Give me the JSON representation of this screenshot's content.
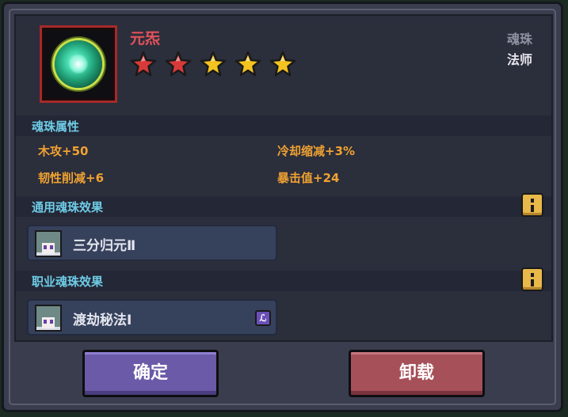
{
  "item": {
    "name": "元炁",
    "stars": 5,
    "star_colors": [
      "#d83a3a",
      "#d83a3a",
      "#f3c31f",
      "#f3c31f",
      "#f3c31f"
    ],
    "icon": "green-orb-icon"
  },
  "category": {
    "type": "魂珠",
    "class": "法师"
  },
  "attributes": {
    "title": "魂珠属性",
    "stats": [
      "木攻+50",
      "冷却缩减+3%",
      "韧性削减+6",
      "暴击值+24"
    ]
  },
  "general_effect": {
    "title": "通用魂珠效果",
    "effect_name": "三分归元Ⅱ"
  },
  "class_effect": {
    "title": "职业魂珠效果",
    "effect_name": "渡劫秘法Ⅰ",
    "mark_glyph": "ℒ"
  },
  "buttons": {
    "confirm": "确定",
    "unload": "卸载"
  }
}
